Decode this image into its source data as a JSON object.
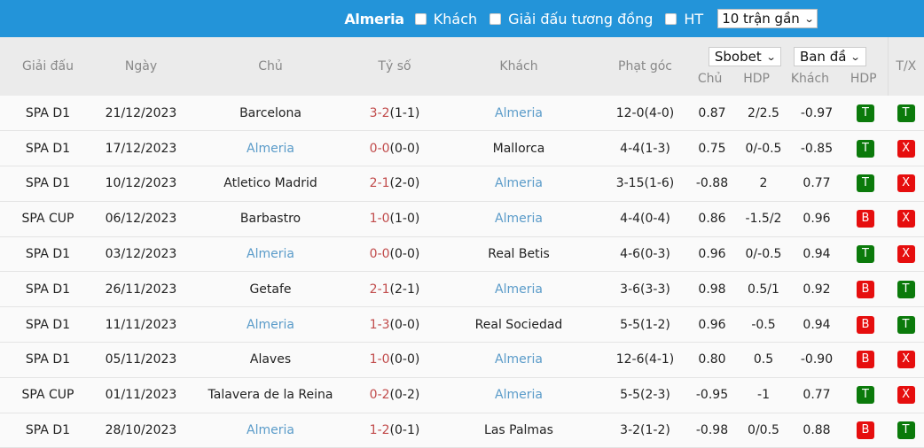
{
  "topbar": {
    "team": "Almeria",
    "options": [
      {
        "label": "Khách",
        "checked": false
      },
      {
        "label": "Giải đấu tương đồng",
        "checked": false
      },
      {
        "label": "HT",
        "checked": false
      }
    ],
    "range_select": "10 trận gần"
  },
  "header": {
    "league": "Giải đấu",
    "date": "Ngày",
    "home": "Chủ",
    "score": "Tỷ số",
    "away": "Khách",
    "corners": "Phạt góc",
    "bookmaker_select": "Sbobet",
    "odds_type_select": "Ban đầ",
    "odds_home": "Chủ",
    "odds_hdp": "HDP",
    "odds_away": "Khách",
    "result_hdp": "HDP",
    "result_tx": "T/X"
  },
  "colors": {
    "topbar": "#2394d9",
    "highlight_team": "#5a9bc9",
    "score_ft": "#c14b4b",
    "badge_green": "#0b7a0b",
    "badge_red": "#e60e0e"
  },
  "rows": [
    {
      "league": "SPA D1",
      "date": "21/12/2023",
      "home": "Barcelona",
      "home_hl": false,
      "score": "3-2",
      "ht": "(1-1)",
      "away": "Almeria",
      "away_hl": true,
      "corners": "12-0(4-0)",
      "o_home": "0.87",
      "hdp": "2/2.5",
      "o_away": "-0.97",
      "r_hdp": "T",
      "r_tx": "T"
    },
    {
      "league": "SPA D1",
      "date": "17/12/2023",
      "home": "Almeria",
      "home_hl": true,
      "score": "0-0",
      "ht": "(0-0)",
      "away": "Mallorca",
      "away_hl": false,
      "corners": "4-4(1-3)",
      "o_home": "0.75",
      "hdp": "0/-0.5",
      "o_away": "-0.85",
      "r_hdp": "T",
      "r_tx": "X"
    },
    {
      "league": "SPA D1",
      "date": "10/12/2023",
      "home": "Atletico Madrid",
      "home_hl": false,
      "score": "2-1",
      "ht": "(2-0)",
      "away": "Almeria",
      "away_hl": true,
      "corners": "3-15(1-6)",
      "o_home": "-0.88",
      "hdp": "2",
      "o_away": "0.77",
      "r_hdp": "T",
      "r_tx": "X"
    },
    {
      "league": "SPA CUP",
      "date": "06/12/2023",
      "home": "Barbastro",
      "home_hl": false,
      "score": "1-0",
      "ht": "(1-0)",
      "away": "Almeria",
      "away_hl": true,
      "corners": "4-4(0-4)",
      "o_home": "0.86",
      "hdp": "-1.5/2",
      "o_away": "0.96",
      "r_hdp": "B",
      "r_tx": "X"
    },
    {
      "league": "SPA D1",
      "date": "03/12/2023",
      "home": "Almeria",
      "home_hl": true,
      "score": "0-0",
      "ht": "(0-0)",
      "away": "Real Betis",
      "away_hl": false,
      "corners": "4-6(0-3)",
      "o_home": "0.96",
      "hdp": "0/-0.5",
      "o_away": "0.94",
      "r_hdp": "T",
      "r_tx": "X"
    },
    {
      "league": "SPA D1",
      "date": "26/11/2023",
      "home": "Getafe",
      "home_hl": false,
      "score": "2-1",
      "ht": "(2-1)",
      "away": "Almeria",
      "away_hl": true,
      "corners": "3-6(3-3)",
      "o_home": "0.98",
      "hdp": "0.5/1",
      "o_away": "0.92",
      "r_hdp": "B",
      "r_tx": "T"
    },
    {
      "league": "SPA D1",
      "date": "11/11/2023",
      "home": "Almeria",
      "home_hl": true,
      "score": "1-3",
      "ht": "(0-0)",
      "away": "Real Sociedad",
      "away_hl": false,
      "corners": "5-5(1-2)",
      "o_home": "0.96",
      "hdp": "-0.5",
      "o_away": "0.94",
      "r_hdp": "B",
      "r_tx": "T"
    },
    {
      "league": "SPA D1",
      "date": "05/11/2023",
      "home": "Alaves",
      "home_hl": false,
      "score": "1-0",
      "ht": "(0-0)",
      "away": "Almeria",
      "away_hl": true,
      "corners": "12-6(4-1)",
      "o_home": "0.80",
      "hdp": "0.5",
      "o_away": "-0.90",
      "r_hdp": "B",
      "r_tx": "X"
    },
    {
      "league": "SPA CUP",
      "date": "01/11/2023",
      "home": "Talavera de la Reina",
      "home_hl": false,
      "score": "0-2",
      "ht": "(0-2)",
      "away": "Almeria",
      "away_hl": true,
      "corners": "5-5(2-3)",
      "o_home": "-0.95",
      "hdp": "-1",
      "o_away": "0.77",
      "r_hdp": "T",
      "r_tx": "X"
    },
    {
      "league": "SPA D1",
      "date": "28/10/2023",
      "home": "Almeria",
      "home_hl": true,
      "score": "1-2",
      "ht": "(0-1)",
      "away": "Las Palmas",
      "away_hl": false,
      "corners": "3-2(1-2)",
      "o_home": "-0.98",
      "hdp": "0/0.5",
      "o_away": "0.88",
      "r_hdp": "B",
      "r_tx": "T"
    }
  ]
}
